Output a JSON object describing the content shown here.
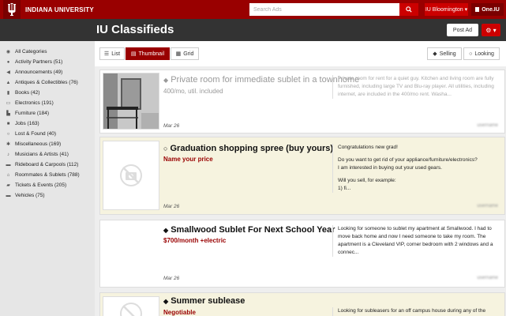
{
  "header": {
    "university_name": "INDIANA UNIVERSITY",
    "search_placeholder": "Search Ads",
    "campus_label": "IU Bloomington ▾",
    "oneiu_label": "One.IU"
  },
  "titlebar": {
    "title": "IU Classifieds",
    "post_ad_label": "Post Ad",
    "gear_label": "⚙ ▾"
  },
  "sidebar": {
    "categories": [
      {
        "label": "All Categories",
        "icon": "globe-icon"
      },
      {
        "label": "Activity Partners (51)",
        "icon": "person-icon"
      },
      {
        "label": "Announcements (49)",
        "icon": "megaphone-icon"
      },
      {
        "label": "Antiques & Collectibles (76)",
        "icon": "lamp-icon"
      },
      {
        "label": "Books (42)",
        "icon": "book-icon"
      },
      {
        "label": "Electronics (191)",
        "icon": "desktop-icon"
      },
      {
        "label": "Furniture (184)",
        "icon": "chair-icon"
      },
      {
        "label": "Jobs (163)",
        "icon": "briefcase-icon"
      },
      {
        "label": "Lost & Found (40)",
        "icon": "search-icon"
      },
      {
        "label": "Miscellaneous (169)",
        "icon": "asterisk-icon"
      },
      {
        "label": "Musicians & Artists (41)",
        "icon": "music-icon"
      },
      {
        "label": "Rideboard & Carpools (112)",
        "icon": "car-icon"
      },
      {
        "label": "Roommates & Sublets (788)",
        "icon": "home-icon"
      },
      {
        "label": "Tickets & Events (205)",
        "icon": "ticket-icon"
      },
      {
        "label": "Vehicles (75)",
        "icon": "truck-icon"
      }
    ]
  },
  "toolbar": {
    "view_list": "List",
    "view_thumbnail": "Thumbnail",
    "view_grid": "Grid",
    "filter_selling": "Selling",
    "filter_looking": "Looking"
  },
  "listings": [
    {
      "title": "Private room for immediate sublet in a townhome",
      "price": "400/mo, util. included",
      "description": "Private room for rent for a quiet guy. Kitchen and living room are fully furnished, including large TV and Blu-ray player. All utilities, including internet, are included in the 400/mo rent. Washa...",
      "date": "Mar 26",
      "user": "username"
    },
    {
      "title": "Graduation shopping spree (buy yours)",
      "price": "Name your price",
      "description_lines": [
        "Congratulations new grad!",
        "",
        "Do you want to get rid of your appliance/furniture/electronics?",
        "I am interested in buying out your used gears.",
        "",
        "Will you sell, for example:",
        "1) fi..."
      ],
      "date": "Mar 26",
      "user": "username"
    },
    {
      "title": "Smallwood Sublet For Next School Year",
      "price": "$700/month +electric",
      "description": "Looking for someone to sublet my apartment at Smallwood. I had to move back home and now I need someone to take my room. The apartment is a Cleveland VIP, corner bedroom with 2 windows and a connec...",
      "date": "Mar 26",
      "user": "username"
    },
    {
      "title": "Summer sublease",
      "price": "Negotiable",
      "description": "Looking for subleasers for an off campus house during any of the 2018..."
    }
  ]
}
